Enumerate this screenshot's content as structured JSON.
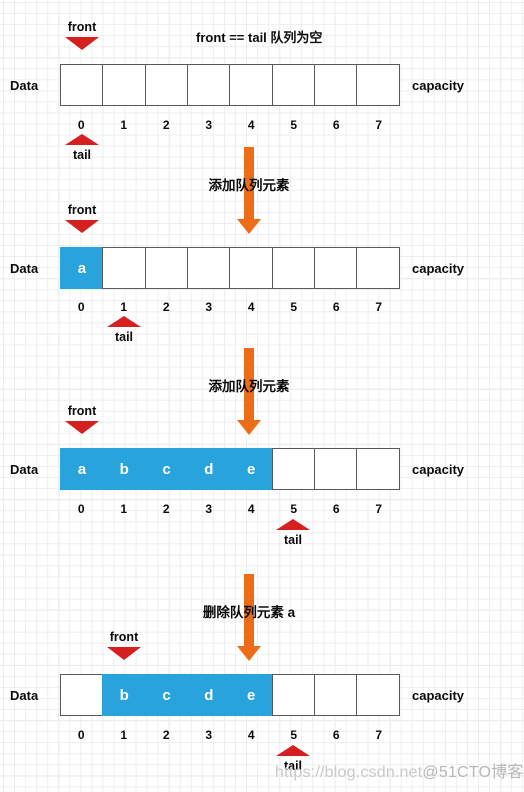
{
  "diagram": {
    "title_caption": "front == tail 队列为空",
    "labels": {
      "data": "Data",
      "capacity": "capacity",
      "front": "front",
      "tail": "tail"
    },
    "indices": [
      "0",
      "1",
      "2",
      "3",
      "4",
      "5",
      "6",
      "7"
    ],
    "colors": {
      "filled_cell": "#29a3dc",
      "cell_border": "#595959",
      "pointer_red": "#d61f1f",
      "action_orange": "#ed6c17",
      "text": "#0a0a0a",
      "grid_minor": "#eceef0",
      "grid_major": "#e0e3e7"
    },
    "capacity": 8,
    "rows": [
      {
        "id": "row-empty-queue",
        "data_label": "Data",
        "capacity_label": "capacity",
        "caption": "front == tail 队列为空",
        "cells": [
          "",
          "",
          "",
          "",
          "",
          "",
          "",
          ""
        ],
        "filled_count": 0,
        "front_label": "front",
        "front_index": 0,
        "tail_label": "tail",
        "tail_index": 0
      },
      {
        "id": "row-one-element",
        "data_label": "Data",
        "capacity_label": "capacity",
        "cells": [
          "a",
          "",
          "",
          "",
          "",
          "",
          "",
          ""
        ],
        "filled_count": 1,
        "front_label": "front",
        "front_index": 0,
        "tail_label": "tail",
        "tail_index": 1
      },
      {
        "id": "row-five-elements",
        "data_label": "Data",
        "capacity_label": "capacity",
        "cells": [
          "a",
          "b",
          "c",
          "d",
          "e",
          "",
          "",
          ""
        ],
        "filled_count": 5,
        "front_label": "front",
        "front_index": 0,
        "tail_label": "tail",
        "tail_index": 5
      },
      {
        "id": "row-after-dequeue",
        "data_label": "Data",
        "capacity_label": "capacity",
        "cells": [
          "",
          "b",
          "c",
          "d",
          "e",
          "",
          "",
          ""
        ],
        "filled_count": 4,
        "front_label": "front",
        "front_index": 1,
        "tail_label": "tail",
        "tail_index": 5
      }
    ],
    "actions": [
      {
        "id": "action-enqueue-1",
        "label": "添加队列元素"
      },
      {
        "id": "action-enqueue-2",
        "label": "添加队列元素"
      },
      {
        "id": "action-dequeue",
        "label": "删除队列元素 a"
      }
    ],
    "watermark": {
      "url": "https://blog.csdn.net",
      "tail": "@51CTO博客"
    }
  }
}
